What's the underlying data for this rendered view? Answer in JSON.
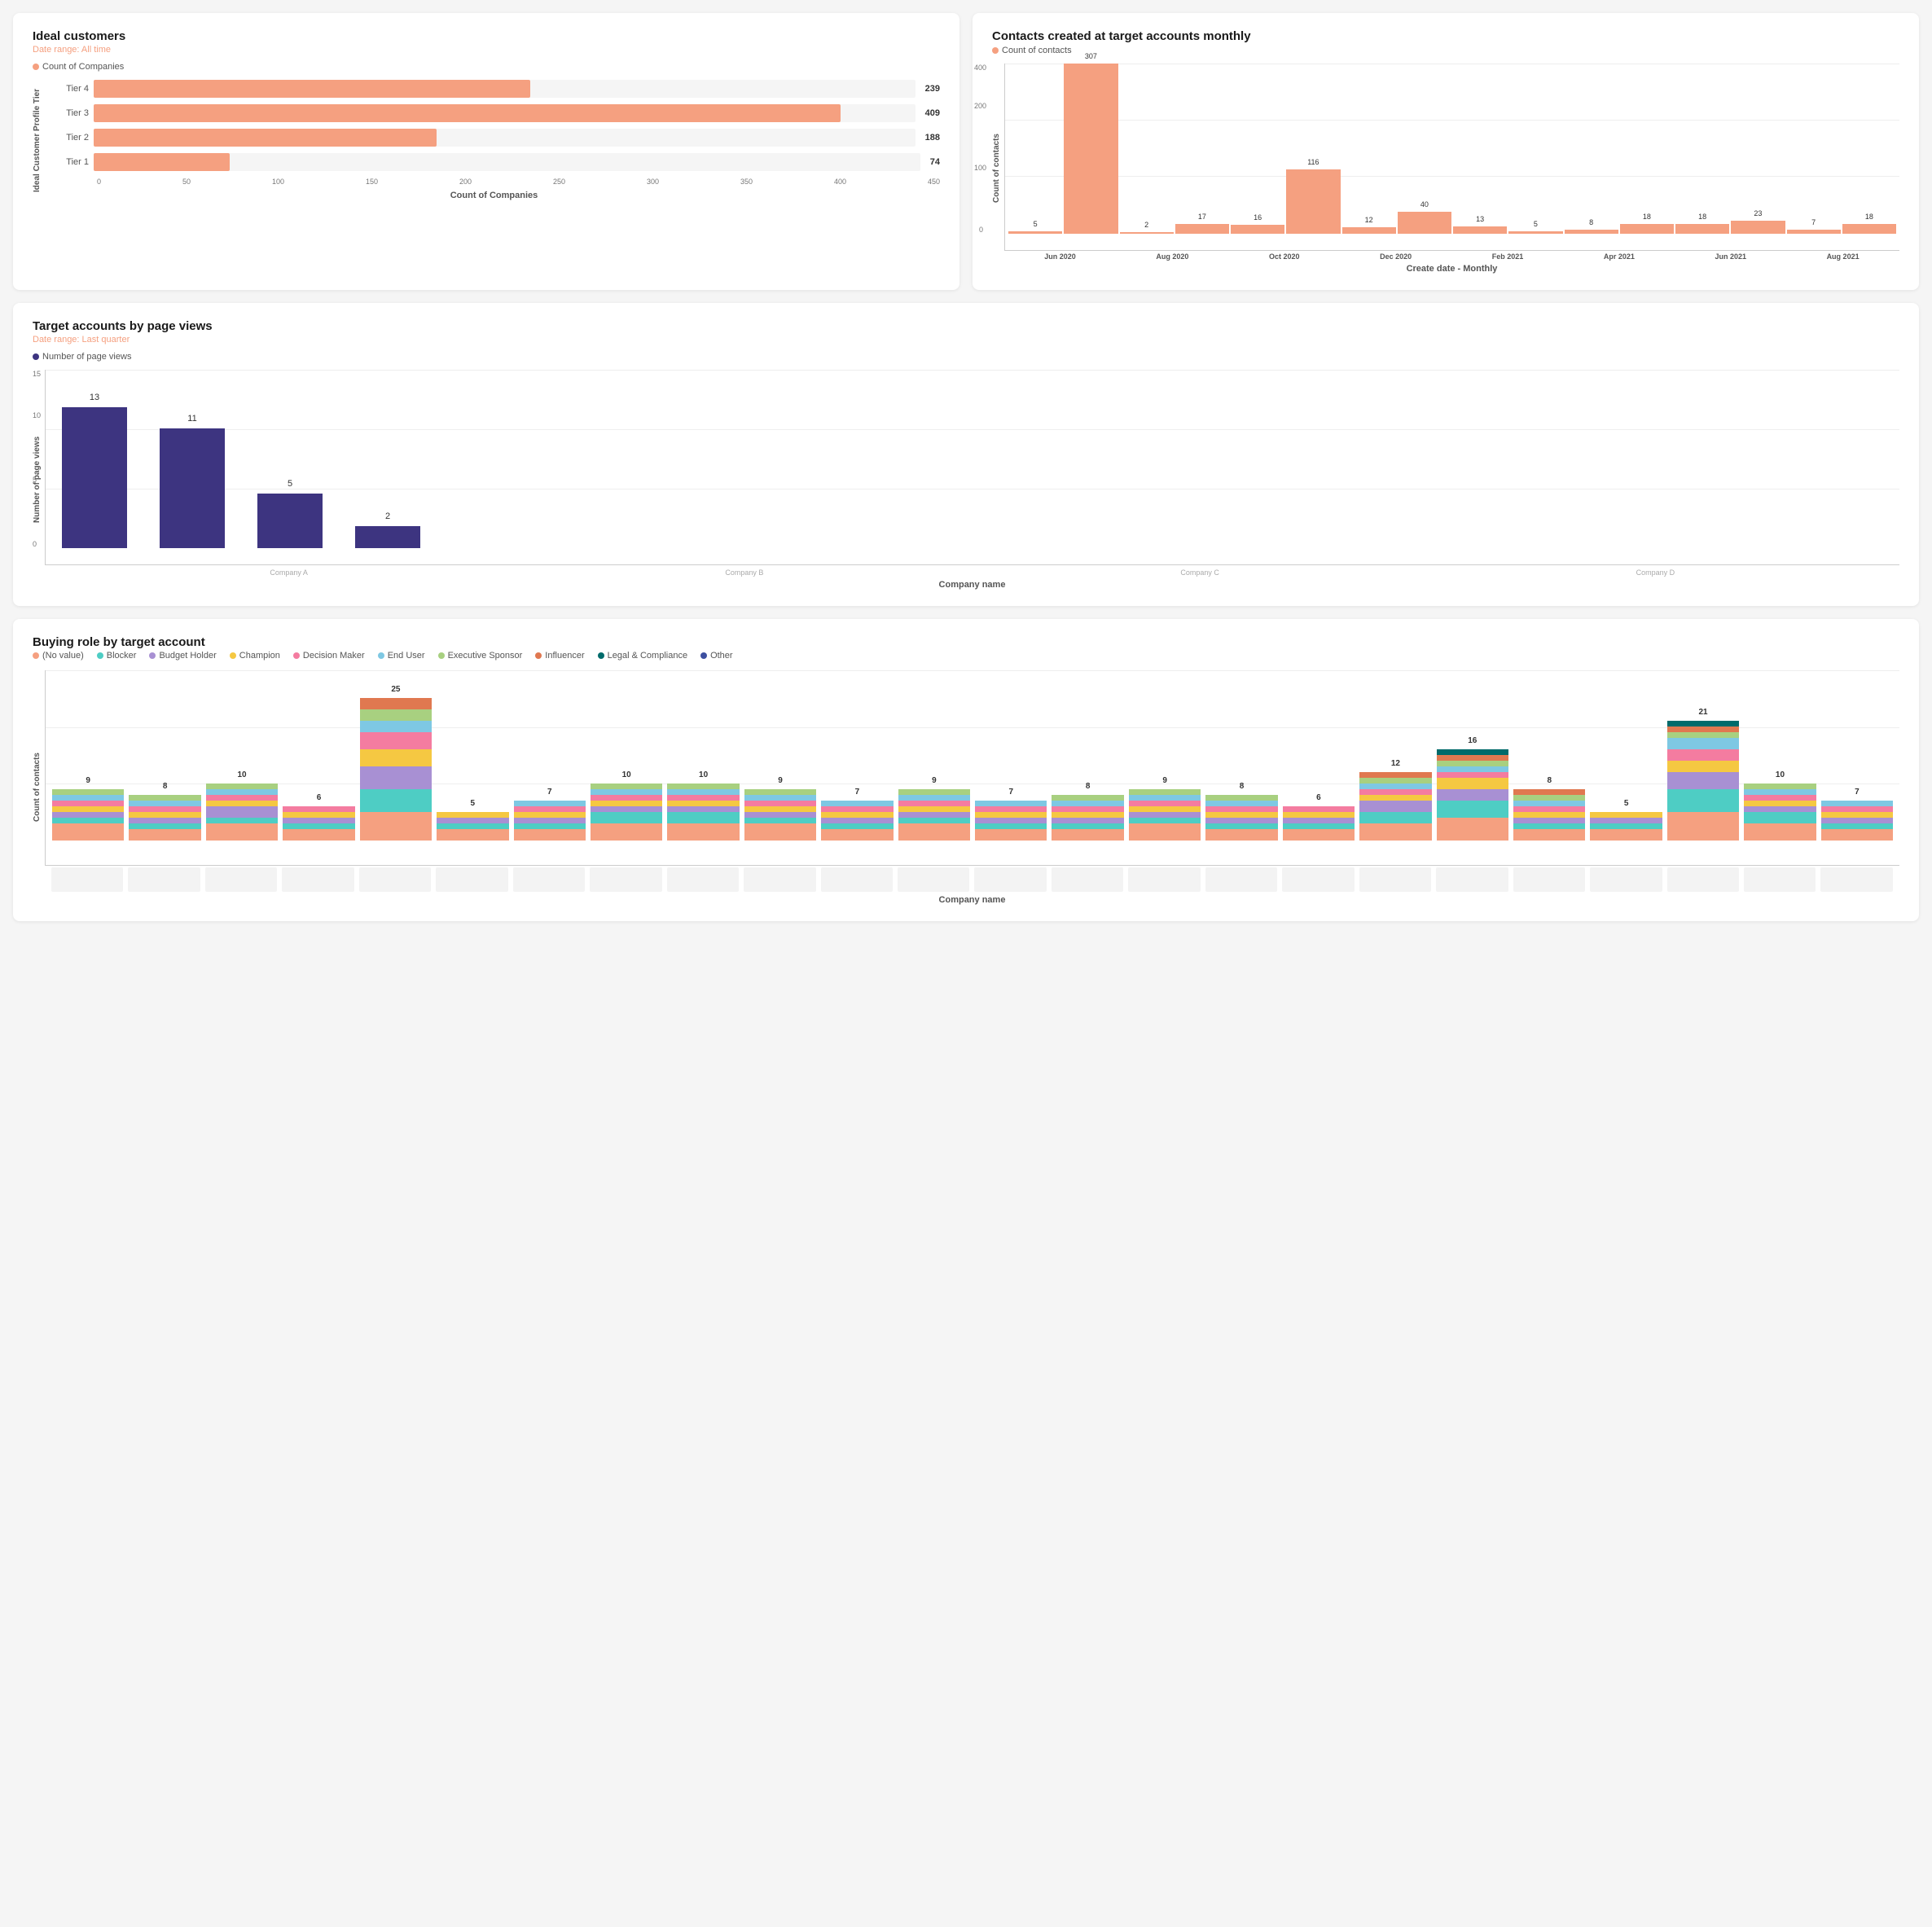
{
  "charts": {
    "ideal_customers": {
      "title": "Ideal customers",
      "subtitle": "Date range: All time",
      "legend": "Count of Companies",
      "legend_color": "#f5a080",
      "x_label": "Count of Companies",
      "y_label": "Ideal Customer Profile Tier",
      "max": 450,
      "bars": [
        {
          "label": "Tier 1",
          "value": 74,
          "max": 450
        },
        {
          "label": "Tier 2",
          "value": 188,
          "max": 450
        },
        {
          "label": "Tier 3",
          "value": 409,
          "max": 450
        },
        {
          "label": "Tier 4",
          "value": 239,
          "max": 450
        }
      ],
      "x_ticks": [
        0,
        50,
        100,
        150,
        200,
        250,
        300,
        350,
        400,
        450
      ]
    },
    "contacts_monthly": {
      "title": "Contacts created at target accounts monthly",
      "legend": "Count of contacts",
      "legend_color": "#f5a080",
      "x_label": "Create date - Monthly",
      "y_label": "Count of contacts",
      "bars": [
        {
          "label": "Jun 2020",
          "value": 5
        },
        {
          "label": "Aug 2020",
          "value": 307
        },
        {
          "label": "",
          "value": 2
        },
        {
          "label": "Oct 2020",
          "value": 17
        },
        {
          "label": "",
          "value": 16
        },
        {
          "label": "Dec 2020",
          "value": 116
        },
        {
          "label": "",
          "value": 12
        },
        {
          "label": "Feb 2021",
          "value": 40
        },
        {
          "label": "",
          "value": 13
        },
        {
          "label": "Apr 2021",
          "value": 5
        },
        {
          "label": "",
          "value": 8
        },
        {
          "label": "Jun 2021",
          "value": 18
        },
        {
          "label": "",
          "value": 18
        },
        {
          "label": "Aug 2021",
          "value": 23
        },
        {
          "label": "",
          "value": 7
        },
        {
          "label": "",
          "value": 18
        }
      ]
    },
    "page_views": {
      "title": "Target accounts by page views",
      "subtitle": "Date range: Last quarter",
      "legend": "Number of page views",
      "legend_color": "#3d3480",
      "x_label": "Company name",
      "y_label": "Number of page views",
      "bars": [
        {
          "label": "Company A",
          "value": 13
        },
        {
          "label": "Company B",
          "value": 11
        },
        {
          "label": "Company C",
          "value": 5
        },
        {
          "label": "Company D",
          "value": 2
        }
      ]
    },
    "buying_role": {
      "title": "Buying role by target account",
      "x_label": "Company name",
      "y_label": "Count of contacts",
      "legend_items": [
        {
          "label": "(No value)",
          "color": "#f5a080"
        },
        {
          "label": "Blocker",
          "color": "#4ecdc4"
        },
        {
          "label": "Budget Holder",
          "color": "#a890d3"
        },
        {
          "label": "Champion",
          "color": "#f5c842"
        },
        {
          "label": "Decision Maker",
          "color": "#f47ca0"
        },
        {
          "label": "End User",
          "color": "#7ec8e3"
        },
        {
          "label": "Executive Sponsor",
          "color": "#a8d080"
        },
        {
          "label": "Influencer",
          "color": "#e07850"
        },
        {
          "label": "Legal & Compliance",
          "color": "#006b6b"
        },
        {
          "label": "Other",
          "color": "#3d4fa0"
        }
      ],
      "bars": [
        {
          "total": 9,
          "segments": [
            3,
            1,
            1,
            1,
            1,
            1,
            1
          ]
        },
        {
          "total": 8,
          "segments": [
            2,
            1,
            1,
            1,
            1,
            1,
            1
          ]
        },
        {
          "total": 10,
          "segments": [
            3,
            1,
            2,
            1,
            1,
            1,
            1
          ]
        },
        {
          "total": 6,
          "segments": [
            2,
            1,
            1,
            1,
            1
          ]
        },
        {
          "total": 25,
          "segments": [
            5,
            4,
            4,
            3,
            3,
            2,
            2,
            2
          ]
        },
        {
          "total": 5,
          "segments": [
            2,
            1,
            1,
            1
          ]
        },
        {
          "total": 7,
          "segments": [
            2,
            1,
            1,
            1,
            1,
            1
          ]
        },
        {
          "total": 10,
          "segments": [
            3,
            2,
            1,
            1,
            1,
            1,
            1
          ]
        },
        {
          "total": 10,
          "segments": [
            3,
            2,
            1,
            1,
            1,
            1,
            1
          ]
        },
        {
          "total": 9,
          "segments": [
            3,
            1,
            1,
            1,
            1,
            1,
            1
          ]
        },
        {
          "total": 7,
          "segments": [
            2,
            1,
            1,
            1,
            1,
            1
          ]
        },
        {
          "total": 9,
          "segments": [
            3,
            1,
            1,
            1,
            1,
            1,
            1
          ]
        },
        {
          "total": 7,
          "segments": [
            2,
            1,
            1,
            1,
            1,
            1
          ]
        },
        {
          "total": 8,
          "segments": [
            2,
            1,
            1,
            1,
            1,
            1,
            1
          ]
        },
        {
          "total": 9,
          "segments": [
            3,
            1,
            1,
            1,
            1,
            1,
            1
          ]
        },
        {
          "total": 8,
          "segments": [
            2,
            1,
            1,
            1,
            1,
            1,
            1
          ]
        },
        {
          "total": 6,
          "segments": [
            2,
            1,
            1,
            1,
            1
          ]
        },
        {
          "total": 12,
          "segments": [
            3,
            2,
            2,
            1,
            1,
            1,
            1,
            1
          ]
        },
        {
          "total": 16,
          "segments": [
            4,
            3,
            2,
            2,
            1,
            1,
            1,
            1,
            1
          ]
        },
        {
          "total": 8,
          "segments": [
            2,
            1,
            1,
            1,
            1,
            1,
            1,
            1
          ]
        },
        {
          "total": 5,
          "segments": [
            2,
            1,
            1,
            1
          ]
        },
        {
          "total": 21,
          "segments": [
            5,
            4,
            3,
            2,
            2,
            2,
            1,
            1,
            1
          ]
        },
        {
          "total": 10,
          "segments": [
            3,
            2,
            1,
            1,
            1,
            1,
            1
          ]
        },
        {
          "total": 7,
          "segments": [
            2,
            1,
            1,
            1,
            1,
            1
          ]
        }
      ]
    }
  }
}
